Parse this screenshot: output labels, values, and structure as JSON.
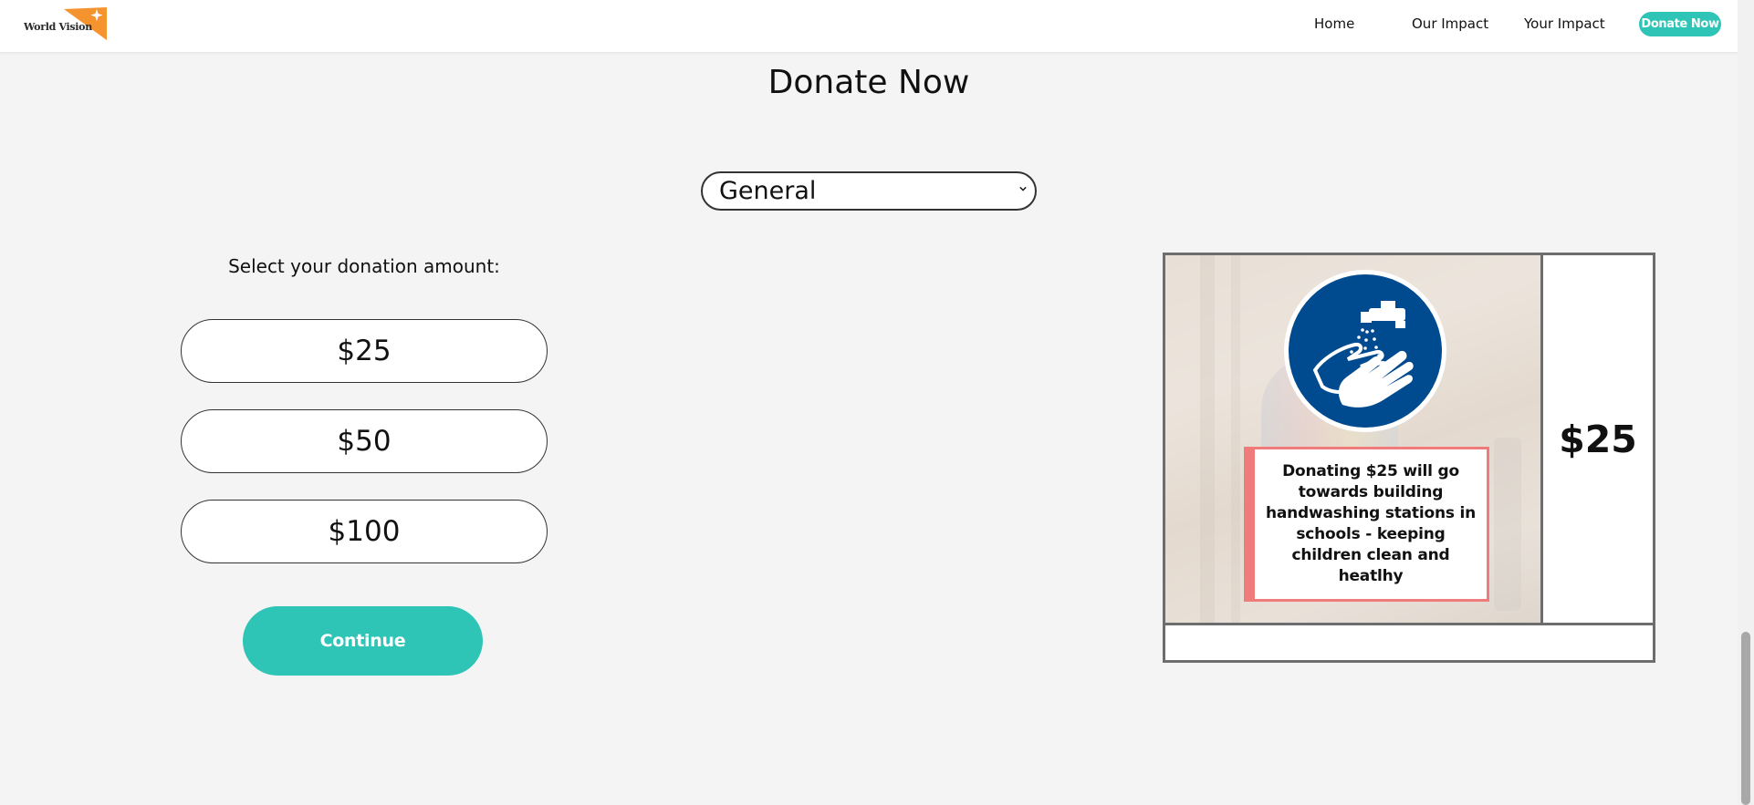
{
  "nav": {
    "logo_text": "World Vision",
    "links": [
      "Home",
      "Our Impact",
      "Your Impact"
    ],
    "cta": "Donate Now"
  },
  "page": {
    "title": "Donate Now"
  },
  "cause_select": {
    "selected": "General"
  },
  "donation": {
    "prompt": "Select your donation amount:",
    "amounts": [
      "$25",
      "$50",
      "$100"
    ],
    "continue_label": "Continue"
  },
  "card": {
    "description": "Donating $25 will go towards building handwashing stations in schools - keeping children clean and heatlhy",
    "amount": "$25",
    "icon": "handwashing-icon"
  },
  "colors": {
    "accent": "#2ec4b6",
    "logo_orange": "#f5932f",
    "icon_blue": "#004a8f",
    "text_box_border": "#f07b7b"
  }
}
